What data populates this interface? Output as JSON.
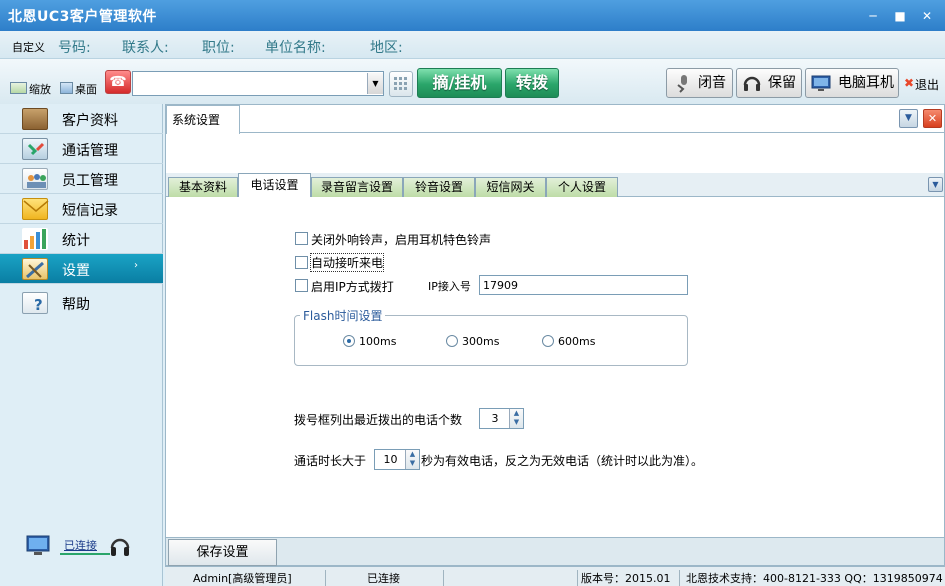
{
  "app": {
    "title": "北恩UC3客户管理软件"
  },
  "infobar": {
    "custom": "自定义",
    "number": "号码:",
    "contact": "联系人:",
    "position": "职位:",
    "company": "单位名称:",
    "region": "地区:"
  },
  "toolbar": {
    "zoom_label": "缩放",
    "desktop_label": "桌面",
    "phone_input_value": "",
    "pickup_label": "摘/挂机",
    "transfer_label": "转拨",
    "mute_label": "闭音",
    "hold_label": "保留",
    "headset_label": "电脑耳机",
    "exit_label": "退出"
  },
  "sidebar": {
    "items": [
      {
        "label": "客户资料",
        "icon": "customer-icon"
      },
      {
        "label": "通话管理",
        "icon": "call-icon"
      },
      {
        "label": "员工管理",
        "icon": "staff-icon"
      },
      {
        "label": "短信记录",
        "icon": "sms-icon"
      },
      {
        "label": "统计",
        "icon": "chart-icon"
      },
      {
        "label": "设置",
        "icon": "settings-icon",
        "active": true
      },
      {
        "label": "帮助",
        "icon": "help-icon"
      }
    ],
    "connection_status": "已连接"
  },
  "main": {
    "top_tab": "系统设置",
    "subtabs": [
      "基本资料",
      "电话设置",
      "录音留言设置",
      "铃音设置",
      "短信网关",
      "个人设置"
    ],
    "active_subtab": "电话设置",
    "options": {
      "close_ringer": "关闭外响铃声，启用耳机特色铃声",
      "auto_answer": "自动接听来电",
      "ip_dial": "启用IP方式拨打",
      "ip_access_label": "IP接入号",
      "ip_access_value": "17909"
    },
    "flash": {
      "title": "Flash时间设置",
      "options": [
        "100ms",
        "300ms",
        "600ms"
      ],
      "selected": "100ms"
    },
    "recent_calls": {
      "label": "拨号框列出最近拨出的电话个数",
      "value": "3"
    },
    "valid_call": {
      "prefix": "通话时长大于",
      "value": "10",
      "suffix": "秒为有效电话，反之为无效电话（统计时以此为准）。"
    },
    "save_label": "保存设置"
  },
  "statusbar": {
    "user": "Admin[高级管理员]",
    "connection": "已连接",
    "version": "版本号：2015.01",
    "support": "北恩技术支持：400-8121-333 QQ：1319850974"
  },
  "colors": {
    "accent": "#0a7ea3",
    "titlebar": "#2d7ec9",
    "green_button": "#2aa56a",
    "close_button": "#e8472a"
  }
}
